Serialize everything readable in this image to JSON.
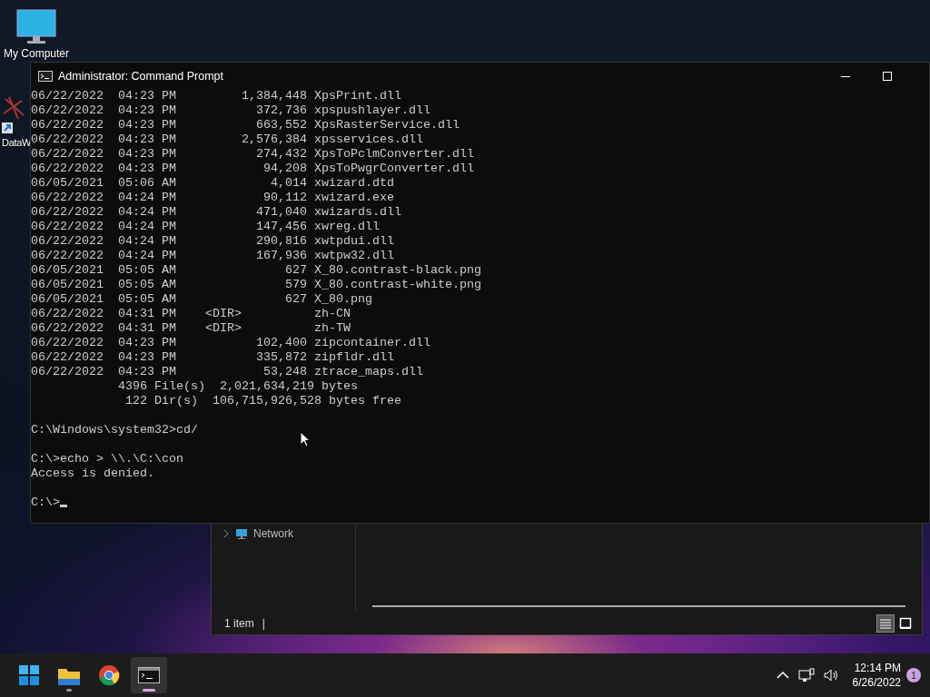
{
  "desktop_icons": [
    {
      "kind": "computer",
      "label": "My Computer"
    },
    {
      "kind": "shortcut",
      "label": "DataW"
    }
  ],
  "console": {
    "title": "Administrator: Command Prompt",
    "blocks": [
      {
        "lines": [
          "06/22/2022  04:23 PM         1,384,448 XpsPrint.dll",
          "06/22/2022  04:23 PM           372,736 xpspushlayer.dll",
          "06/22/2022  04:23 PM           663,552 XpsRasterService.dll",
          "06/22/2022  04:23 PM         2,576,384 xpsservices.dll",
          "06/22/2022  04:23 PM           274,432 XpsToPclmConverter.dll",
          "06/22/2022  04:23 PM            94,208 XpsToPwgrConverter.dll",
          "06/05/2021  05:06 AM             4,014 xwizard.dtd",
          "06/22/2022  04:24 PM            90,112 xwizard.exe",
          "06/22/2022  04:24 PM           471,040 xwizards.dll",
          "06/22/2022  04:24 PM           147,456 xwreg.dll",
          "06/22/2022  04:24 PM           290,816 xwtpdui.dll",
          "06/22/2022  04:24 PM           167,936 xwtpw32.dll",
          "06/05/2021  05:05 AM               627 X_80.contrast-black.png",
          "06/05/2021  05:05 AM               579 X_80.contrast-white.png",
          "06/05/2021  05:05 AM               627 X_80.png",
          "06/22/2022  04:31 PM    <DIR>          zh-CN",
          "06/22/2022  04:31 PM    <DIR>          zh-TW",
          "06/22/2022  04:23 PM           102,400 zipcontainer.dll",
          "06/22/2022  04:23 PM           335,872 zipfldr.dll",
          "06/22/2022  04:23 PM            53,248 ztrace_maps.dll",
          "            4396 File(s)  2,021,634,219 bytes",
          "             122 Dir(s)  106,715,926,528 bytes free"
        ]
      },
      {
        "lines": [
          "C:\\Windows\\system32>cd/"
        ]
      },
      {
        "lines": [
          "C:\\>echo > \\\\.\\C:\\con",
          "Access is denied."
        ]
      },
      {
        "lines": [
          "C:\\>"
        ]
      }
    ],
    "cursor": true
  },
  "explorer": {
    "nav_item": "Network",
    "status": "1 item",
    "separator": "|",
    "views": [
      {
        "kind": "details",
        "selected": true
      },
      {
        "kind": "tiles",
        "selected": false
      }
    ]
  },
  "taskbar": {
    "apps": [
      {
        "kind": "start",
        "selected": false,
        "running": false
      },
      {
        "kind": "folder",
        "selected": false,
        "running": true
      },
      {
        "kind": "browser",
        "selected": false,
        "running": false
      },
      {
        "kind": "terminal",
        "selected": true,
        "running": true
      }
    ],
    "time": "12:14 PM",
    "date": "6/26/2022",
    "notifications": "1"
  }
}
